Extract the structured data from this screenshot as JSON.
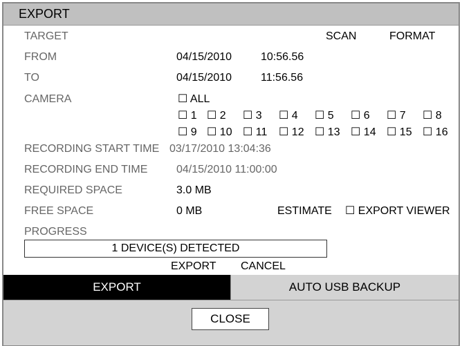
{
  "window": {
    "title": "EXPORT"
  },
  "target": {
    "label": "TARGET",
    "scan": "SCAN",
    "format": "FORMAT"
  },
  "from": {
    "label": "FROM",
    "date": "04/15/2010",
    "time": "10:56.56"
  },
  "to": {
    "label": "TO",
    "date": "04/15/2010",
    "time": "11:56.56"
  },
  "camera": {
    "label": "CAMERA",
    "all": "☐ ALL",
    "channels": [
      "☐ 1",
      "☐ 2",
      "☐ 3",
      "☐ 4",
      "☐ 5",
      "☐ 6",
      "☐ 7",
      "☐ 8",
      "☐ 9",
      "☐ 10",
      "☐ 11",
      "☐ 12",
      "☐ 13",
      "☐ 14",
      "☐ 15",
      "☐ 16"
    ]
  },
  "rec_start": {
    "label": "RECORDING START TIME",
    "value": "03/17/2010 13:04:36"
  },
  "rec_end": {
    "label": "RECORDING END TIME",
    "value": "04/15/2010 11:00:00"
  },
  "required": {
    "label": "REQUIRED SPACE",
    "value": "3.0 MB"
  },
  "free": {
    "label": "FREE SPACE",
    "value": "0 MB",
    "estimate": "ESTIMATE",
    "export_viewer": "☐ EXPORT VIEWER"
  },
  "progress": {
    "label": "PROGRESS",
    "status": "1 DEVICE(S) DETECTED"
  },
  "actions": {
    "export": "EXPORT",
    "cancel": "CANCEL"
  },
  "tabs": [
    {
      "label": "EXPORT",
      "active": true
    },
    {
      "label": "AUTO USB BACKUP",
      "active": false
    }
  ],
  "footer": {
    "close": "CLOSE"
  }
}
